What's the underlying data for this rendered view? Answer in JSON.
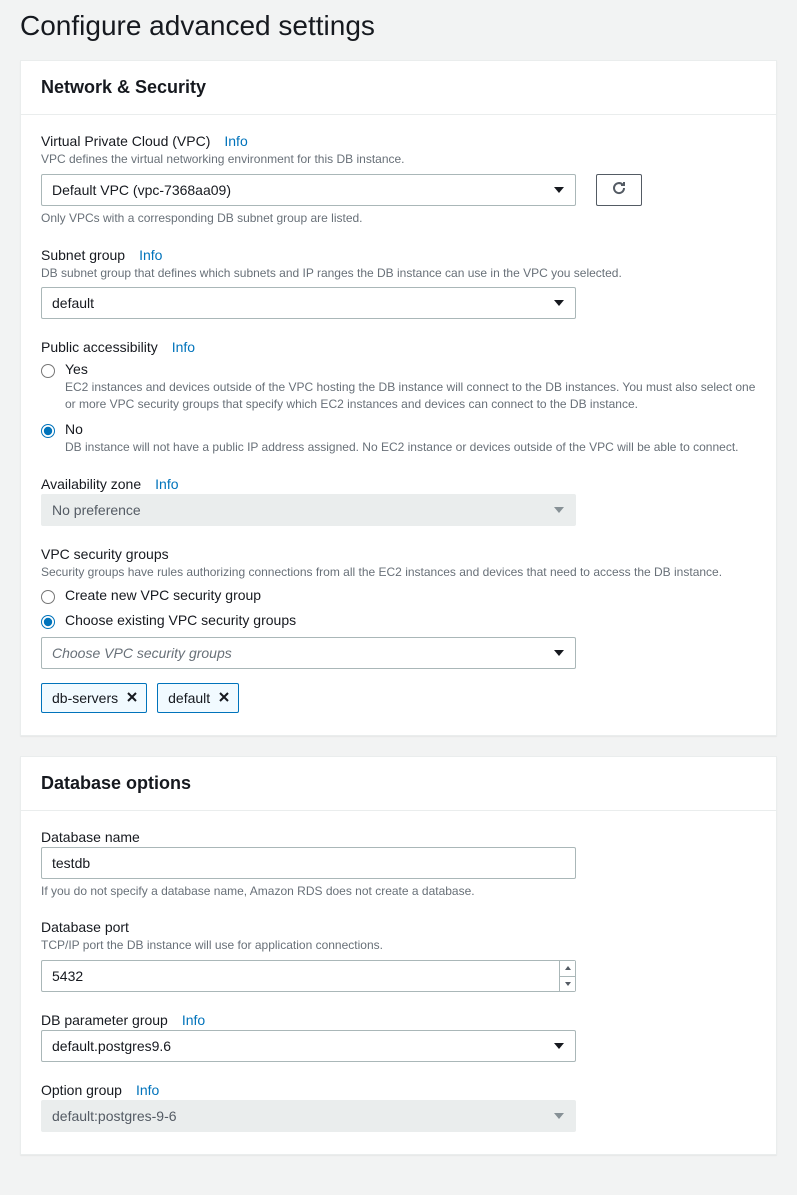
{
  "page_title": "Configure advanced settings",
  "info_label": "Info",
  "network": {
    "header": "Network & Security",
    "vpc": {
      "label": "Virtual Private Cloud (VPC)",
      "desc": "VPC defines the virtual networking environment for this DB instance.",
      "value": "Default VPC (vpc-7368aa09)",
      "hint": "Only VPCs with a corresponding DB subnet group are listed."
    },
    "subnet": {
      "label": "Subnet group",
      "desc": "DB subnet group that defines which subnets and IP ranges the DB instance can use in the VPC you selected.",
      "value": "default"
    },
    "public": {
      "label": "Public accessibility",
      "yes_label": "Yes",
      "yes_desc": "EC2 instances and devices outside of the VPC hosting the DB instance will connect to the DB instances. You must also select one or more VPC security groups that specify which EC2 instances and devices can connect to the DB instance.",
      "no_label": "No",
      "no_desc": "DB instance will not have a public IP address assigned. No EC2 instance or devices outside of the VPC will be able to connect."
    },
    "az": {
      "label": "Availability zone",
      "value": "No preference"
    },
    "sg": {
      "label": "VPC security groups",
      "desc": "Security groups have rules authorizing connections from all the EC2 instances and devices that need to access the DB instance.",
      "create_label": "Create new VPC security group",
      "choose_label": "Choose existing VPC security groups",
      "placeholder": "Choose VPC security groups",
      "tags": [
        "db-servers",
        "default"
      ]
    }
  },
  "dboptions": {
    "header": "Database options",
    "dbname": {
      "label": "Database name",
      "value": "testdb",
      "hint": "If you do not specify a database name, Amazon RDS does not create a database."
    },
    "dbport": {
      "label": "Database port",
      "desc": "TCP/IP port the DB instance will use for application connections.",
      "value": "5432"
    },
    "paramgroup": {
      "label": "DB parameter group",
      "value": "default.postgres9.6"
    },
    "optiongroup": {
      "label": "Option group",
      "value": "default:postgres-9-6"
    }
  }
}
